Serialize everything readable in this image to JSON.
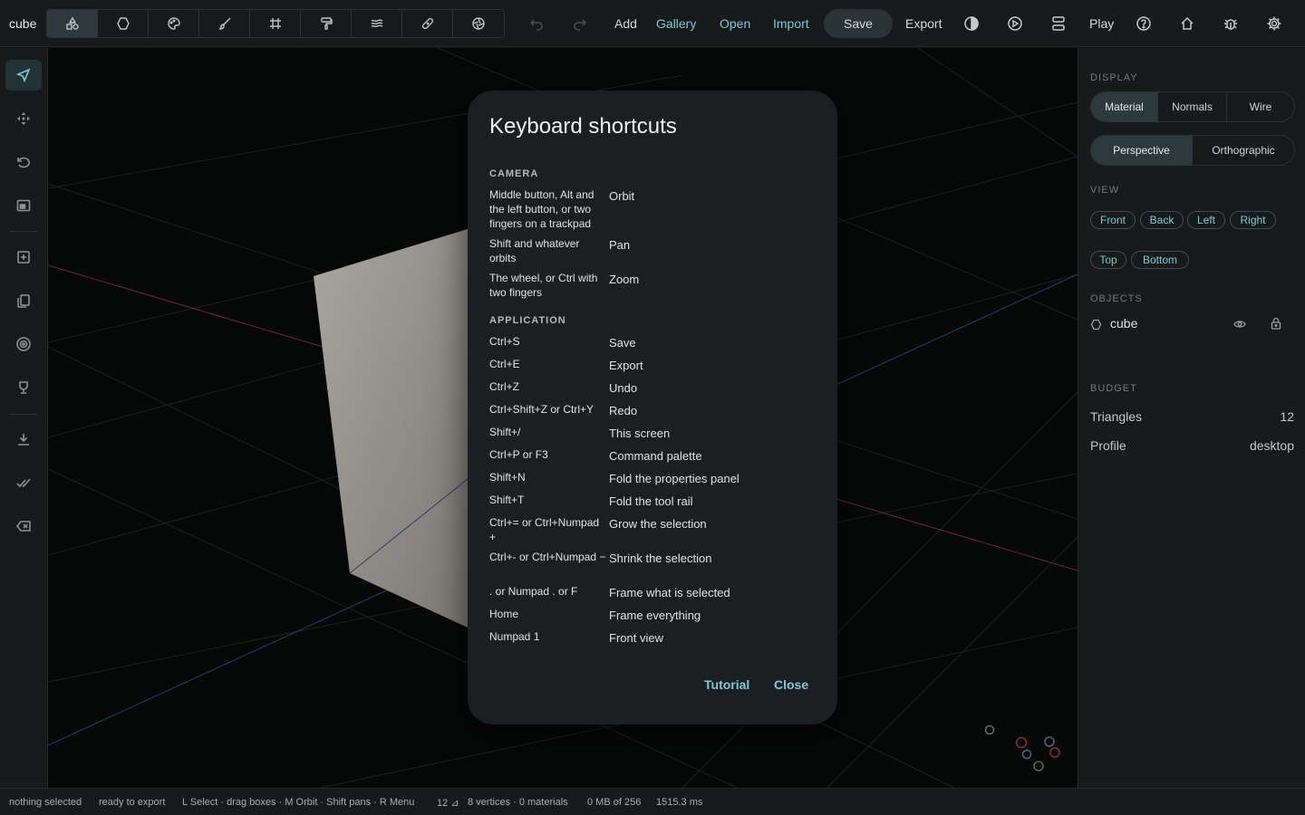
{
  "app": {
    "title": "cube"
  },
  "toolbar": {
    "modes": [
      {
        "icon": "shapes-icon"
      },
      {
        "icon": "circle-icon"
      },
      {
        "icon": "palette-icon"
      },
      {
        "icon": "brush-icon"
      },
      {
        "icon": "grid-icon"
      },
      {
        "icon": "paint-roller-icon"
      },
      {
        "icon": "layers-icon"
      },
      {
        "icon": "bandage-icon"
      },
      {
        "icon": "aperture-icon"
      }
    ],
    "add": "Add",
    "gallery": "Gallery",
    "open": "Open",
    "import": "Import",
    "save": "Save",
    "export": "Export",
    "play": "Play"
  },
  "display": {
    "title": "DISPLAY",
    "shading": [
      "Material",
      "Normals",
      "Wire"
    ],
    "projection": [
      "Perspective",
      "Orthographic"
    ]
  },
  "view": {
    "title": "VIEW",
    "buttons": [
      "Front",
      "Back",
      "Left",
      "Right",
      "Top",
      "Bottom"
    ]
  },
  "objects": {
    "title": "OBJECTS",
    "items": [
      {
        "name": "cube"
      }
    ]
  },
  "budget": {
    "title": "BUDGET",
    "triangles_label": "Triangles",
    "triangles_value": "12",
    "profile_label": "Profile",
    "profile_value": "desktop"
  },
  "status": {
    "selection": "nothing selected",
    "export_state": "ready to export",
    "hints": "L Select · drag boxes · M Orbit · Shift pans · R Menu",
    "triangles": "12 ⊿",
    "geometry": "8 vertices · 0 materials",
    "memory": "0 MB of 256",
    "time": "1515.3 ms"
  },
  "dialog": {
    "title": "Keyboard shortcuts",
    "camera_title": "CAMERA",
    "camera": [
      {
        "keys": "Middle button, Alt and the left button, or two fingers on a trackpad",
        "action": "Orbit"
      },
      {
        "keys": "Shift and whatever orbits",
        "action": "Pan"
      },
      {
        "keys": "The wheel, or Ctrl with two fingers",
        "action": "Zoom"
      }
    ],
    "application_title": "APPLICATION",
    "application": [
      {
        "keys": "Ctrl+S",
        "action": "Save"
      },
      {
        "keys": "Ctrl+E",
        "action": "Export"
      },
      {
        "keys": "Ctrl+Z",
        "action": "Undo"
      },
      {
        "keys": "Ctrl+Shift+Z or Ctrl+Y",
        "action": "Redo"
      },
      {
        "keys": "Shift+/",
        "action": "This screen"
      },
      {
        "keys": "Ctrl+P or F3",
        "action": "Command palette"
      },
      {
        "keys": "Shift+N",
        "action": "Fold the properties panel"
      },
      {
        "keys": "Shift+T",
        "action": "Fold the tool rail"
      },
      {
        "keys": "Ctrl+= or Ctrl+Numpad +",
        "action": "Grow the selection"
      },
      {
        "keys": "Ctrl+- or Ctrl+Numpad −",
        "action": "Shrink the selection"
      },
      {
        "keys": ". or Numpad . or F",
        "action": "Frame what is selected"
      },
      {
        "keys": "Home",
        "action": "Frame everything"
      },
      {
        "keys": "Numpad 1",
        "action": "Front view"
      }
    ],
    "tutorial": "Tutorial",
    "close": "Close"
  },
  "colors": {
    "accent": "#7fc8d4",
    "panel": "#17191b",
    "dialog": "#1c1f22"
  }
}
